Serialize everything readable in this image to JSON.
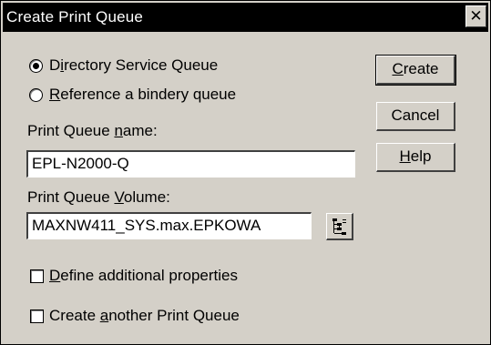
{
  "window": {
    "title": "Create Print Queue",
    "close_glyph": "✕"
  },
  "queue_type": {
    "options": [
      {
        "mnemonic": "i",
        "label": "Directory Service Queue",
        "selected": true
      },
      {
        "mnemonic": "R",
        "label": "Reference a bindery queue",
        "selected": false
      }
    ]
  },
  "queue_name": {
    "label": "Print Queue name:",
    "value": "EPL-N2000-Q"
  },
  "queue_volume": {
    "label": "Print Queue Volume:",
    "value": "MAXNW411_SYS.max.EPKOWA",
    "browse_icon": "tree-browse-icon"
  },
  "options": {
    "define_additional": {
      "label": "Define additional properties",
      "checked": false
    },
    "create_another": {
      "label": "Create another Print Queue",
      "checked": false
    }
  },
  "buttons": {
    "create": "Create",
    "cancel": "Cancel",
    "help": "Help"
  }
}
